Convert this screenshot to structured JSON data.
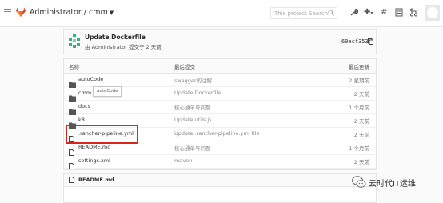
{
  "header": {
    "project_path": "Administrator / cmm",
    "search_placeholder": "This project  Search",
    "icons": [
      "menu-icon",
      "gitlab-logo",
      "wrench-icon",
      "plus-icon",
      "hash-icon",
      "bell-icon",
      "merge-request-icon",
      "avatar"
    ]
  },
  "commit": {
    "title": "Update Dockerfile",
    "meta": "由 Administrator 提交于 2 天前",
    "sha": "60ecf353"
  },
  "table": {
    "columns": {
      "name": "名称",
      "last_commit": "最后提交",
      "last_update": "最后更新"
    },
    "rows": [
      {
        "type": "folder",
        "name": "autoCode",
        "msg": "swagger的注解",
        "time": "2 星期前"
      },
      {
        "type": "folder",
        "name": "cmm",
        "msg": "Update Dockerfile",
        "time": "2 天前"
      },
      {
        "type": "folder",
        "name": "docs",
        "msg": "核心通单号问题",
        "time": "1 个月前"
      },
      {
        "type": "folder",
        "name": "k8",
        "msg": "Update utils.js",
        "time": "2 天前"
      },
      {
        "type": "file",
        "name": ".rancher-pipeline.yml",
        "msg": "Update .rancher-pipeline.yml file",
        "time": "2 天前"
      },
      {
        "type": "file",
        "name": "README.md",
        "msg": "核心通单号问题",
        "time": "1 个月前"
      },
      {
        "type": "file",
        "name": "settings.xml",
        "msg": "maven",
        "time": "2 天前"
      }
    ]
  },
  "tooltip": "autoCode",
  "readme": {
    "label": "README.md"
  },
  "watermark": "云时代IT运维",
  "colors": {
    "highlight": "#d9261c",
    "gitlab_orange": "#e2432a",
    "commit_avatar": "#2bb38a"
  }
}
